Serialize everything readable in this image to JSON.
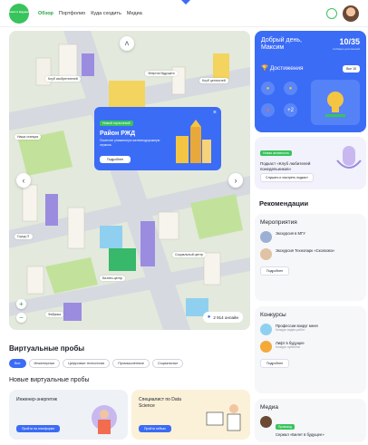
{
  "header": {
    "logo_text": "Билет в будущее",
    "nav": [
      "Обзор",
      "Портфолио",
      "Куда сходить",
      "Медиа"
    ]
  },
  "map": {
    "popup": {
      "badge": "Новый отраслевой",
      "title": "Район РЖД",
      "text": "Посетите уникальную железнодорожную отрасль",
      "button": "Подробнее",
      "close": "×"
    },
    "labels": [
      "Клуб изобретателей",
      "Энергия будущего",
      "Клуб ценностей",
      "Наша станция",
      "Район РЖД",
      "Город IT",
      "Социальный центр",
      "Бизнес-центр",
      "Фабрика"
    ],
    "people_tag": "2 914 онлайн"
  },
  "virtual": {
    "title": "Виртуальные пробы",
    "filters": [
      "Все",
      "Инженерные",
      "Цифровые технологии",
      "Промышленные",
      "Социальные"
    ],
    "new_title": "Новые виртуальные пробы",
    "cards": [
      {
        "title": "Инженер-энергетик",
        "button": "Пройти на платформе"
      },
      {
        "title": "Специалист по Data Science",
        "button": "Пройти сейчас"
      }
    ]
  },
  "greeting": {
    "text": "Добрый день, Максим",
    "score": "10/35",
    "score_label": "Собрано достижений",
    "achievements": "Достижения",
    "all_button": "Все 15",
    "plus": "+2"
  },
  "podcast": {
    "tag": "Новая активность",
    "text": "Подкаст «Клуб любителей понедельников»",
    "button": "Слушать и смотреть подкаст"
  },
  "recommendations": {
    "title": "Рекомендации",
    "events": {
      "heading": "Мероприятия",
      "items": [
        {
          "title": "Экскурсия в МГУ",
          "sub": ""
        },
        {
          "title": "Экскурсия Технопарк «Сколково»",
          "sub": ""
        }
      ],
      "button": "Подробнее"
    },
    "contests": {
      "heading": "Конкурсы",
      "items": [
        {
          "title": "Профессии вокруг меня",
          "sub": "Конкурс видео-работ"
        },
        {
          "title": "Лифт в будущее",
          "sub": "Конкурс проектов"
        }
      ],
      "button": "Подробнее"
    },
    "media": {
      "heading": "Медиа",
      "tag": "Промокод",
      "title": "Сериал «Билет в будущее»"
    }
  },
  "colors": {
    "accent": "#3b6cf6",
    "green": "#37c45b"
  }
}
